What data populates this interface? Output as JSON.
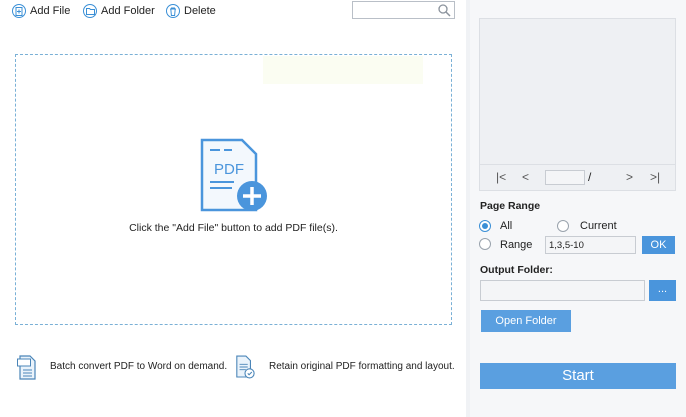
{
  "toolbar": {
    "add_file": "Add File",
    "add_folder": "Add Folder",
    "delete": "Delete",
    "search_placeholder": ""
  },
  "dropzone": {
    "hint": "Click the \"Add File\" button to add PDF file(s).",
    "icon_text": "PDF"
  },
  "features": [
    {
      "text": "Batch convert PDF to Word on demand.",
      "icon": "pdf-doc-icon"
    },
    {
      "text": "Retain original PDF formatting and layout.",
      "icon": "pdf-format-icon"
    }
  ],
  "pager": {
    "first": "|<",
    "prev": "<",
    "current_page": "",
    "separator": "/",
    "next": ">",
    "last": ">|"
  },
  "page_range": {
    "label": "Page Range",
    "options": [
      "All",
      "Current",
      "Range"
    ],
    "selected": "All",
    "range_value": "1,3,5-10",
    "ok_label": "OK"
  },
  "output": {
    "label": "Output Folder:",
    "path": "",
    "browse_label": "...",
    "open_label": "Open Folder"
  },
  "start_label": "Start",
  "colors": {
    "accent": "#4a95dc",
    "dashed_border": "#7ab0d6"
  }
}
